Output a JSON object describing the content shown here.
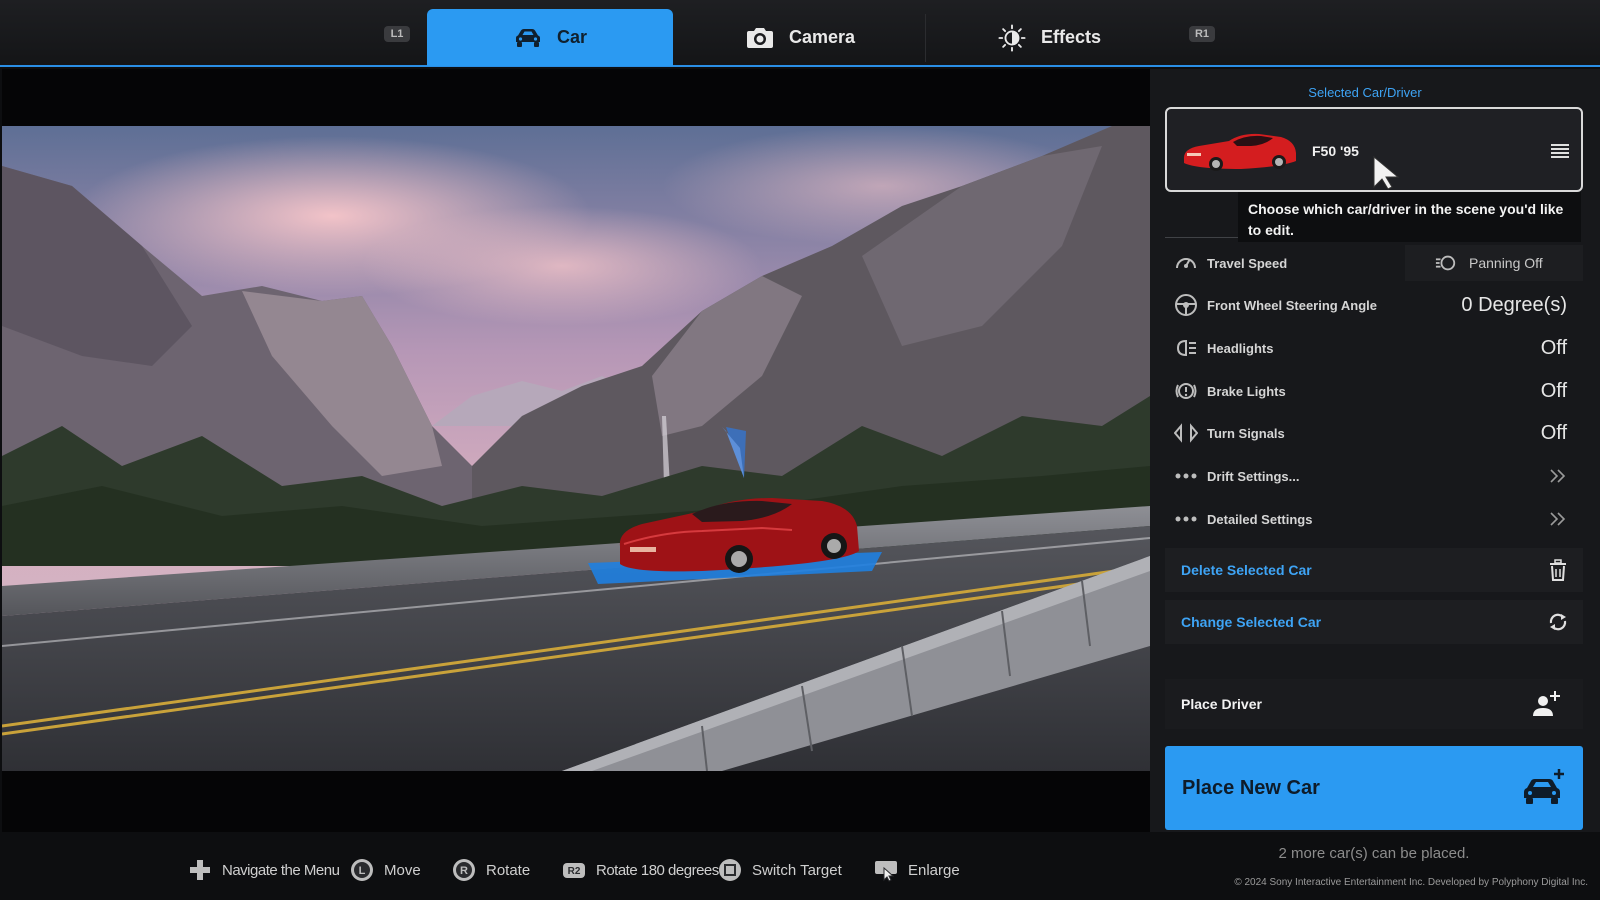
{
  "tabs": {
    "left_shoulder": "L1",
    "right_shoulder": "R1",
    "items": [
      {
        "label": "Car",
        "icon": "car-icon",
        "active": true
      },
      {
        "label": "Camera",
        "icon": "camera-icon",
        "active": false
      },
      {
        "label": "Effects",
        "icon": "brightness-icon",
        "active": false
      }
    ]
  },
  "panel": {
    "selected_label": "Selected Car/Driver",
    "car_name": "F50 '95",
    "tooltip": "Choose which car/driver in the scene you'd like to edit.",
    "settings": [
      {
        "label": "Travel Speed",
        "value": "Panning Off",
        "icon": "speedometer-icon"
      },
      {
        "label": "Front Wheel Steering Angle",
        "value": "0 Degree(s)",
        "icon": "steering-wheel-icon"
      },
      {
        "label": "Headlights",
        "value": "Off",
        "icon": "headlight-icon"
      },
      {
        "label": "Brake Lights",
        "value": "Off",
        "icon": "brake-light-icon"
      },
      {
        "label": "Turn Signals",
        "value": "Off",
        "icon": "turn-signal-icon"
      },
      {
        "label": "Drift Settings...",
        "value": "",
        "icon": "more-dots-icon"
      },
      {
        "label": "Detailed Settings",
        "value": "",
        "icon": "more-dots-icon"
      }
    ],
    "delete_label": "Delete Selected Car",
    "change_label": "Change Selected Car",
    "place_driver_label": "Place Driver",
    "place_car_label": "Place New Car",
    "more_cars": "2 more car(s) can be placed."
  },
  "footer": {
    "hints": [
      {
        "label": "Navigate the Menu",
        "icon": "dpad-icon"
      },
      {
        "label": "Move",
        "icon": "left-stick-icon"
      },
      {
        "label": "Rotate",
        "icon": "right-stick-icon"
      },
      {
        "label": "Rotate 180 degrees",
        "icon": "r2-button-icon"
      },
      {
        "label": "Switch Target",
        "icon": "square-button-icon"
      },
      {
        "label": "Enlarge",
        "icon": "touchpad-icon"
      }
    ],
    "copyright": "© 2024 Sony Interactive Entertainment Inc. Developed by Polyphony Digital Inc."
  },
  "colors": {
    "accent": "#2b9af2",
    "link": "#3ea4f5",
    "panel_bg": "#17181b",
    "car_red": "#c8151b",
    "selection_blue": "#1f7fe0"
  }
}
